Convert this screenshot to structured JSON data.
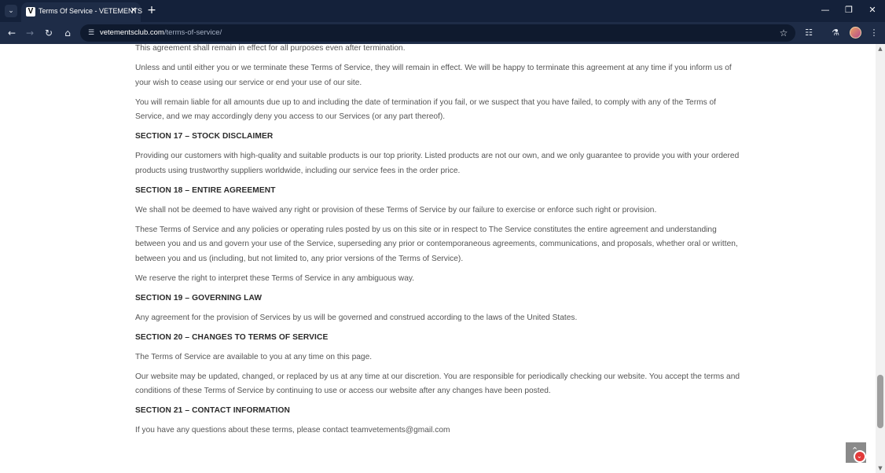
{
  "browser": {
    "tab": {
      "favicon_letter": "V",
      "title": "Terms Of Service - VETEMENTS"
    },
    "address": {
      "host": "vetementsclub.com",
      "path": "/terms-of-service/"
    },
    "icons": {
      "tab_search": "chevron-down-icon",
      "tab_close": "close-icon",
      "new_tab": "plus-icon",
      "minimize": "minimize-icon",
      "restore": "restore-icon",
      "close_window": "close-icon",
      "back": "arrow-left-icon",
      "forward": "arrow-right-icon",
      "reload": "reload-icon",
      "home": "home-icon",
      "site_info": "tune-icon",
      "bookmark": "star-icon",
      "extensions": "puzzle-icon",
      "labs": "flask-icon",
      "menu": "more-vertical-icon"
    },
    "colors": {
      "tabbar": "#14213a",
      "toolbar": "#1e2c47",
      "omnibox": "#0f1a2e"
    }
  },
  "page": {
    "blocks": [
      {
        "type": "p",
        "text": "This agreement shall remain in effect for all purposes even after termination."
      },
      {
        "type": "p",
        "text": "Unless and until either you or we terminate these Terms of Service, they will remain in effect. We will be happy to terminate this agreement at any time if you inform us of your wish to cease using our service or end your use of our site."
      },
      {
        "type": "p",
        "text": "You will remain liable for all amounts due up to and including the date of termination if you fail, or we suspect that you have failed, to comply with any of the Terms of Service, and we may accordingly deny you access to our Services (or any part thereof)."
      },
      {
        "type": "h",
        "text": "SECTION 17 – STOCK DISCLAIMER"
      },
      {
        "type": "p",
        "text": "Providing our customers with high-quality and suitable products is our top priority. Listed products are not our own, and we only guarantee to provide you with your ordered products using trustworthy suppliers worldwide, including our service fees in the order price."
      },
      {
        "type": "h",
        "text": "SECTION 18 – ENTIRE AGREEMENT"
      },
      {
        "type": "p",
        "text": "We shall not be deemed to have waived any right or provision of these Terms of Service by our failure to exercise or enforce such right or provision."
      },
      {
        "type": "p",
        "text": "These Terms of Service and any policies or operating rules posted by us on this site or in respect to The Service constitutes the entire agreement and understanding between you and us and govern your use of the Service, superseding any prior or contemporaneous agreements, communications, and proposals, whether oral or written, between you and us (including, but not limited to, any prior versions of the Terms of Service)."
      },
      {
        "type": "p",
        "text": "We reserve the right to interpret these Terms of Service in any ambiguous way."
      },
      {
        "type": "h",
        "text": "SECTION 19 – GOVERNING LAW"
      },
      {
        "type": "p",
        "text": "Any agreement for the provision of Services by us will be governed and construed according to the laws of the United States."
      },
      {
        "type": "h",
        "text": "SECTION 20 – CHANGES TO TERMS OF SERVICE"
      },
      {
        "type": "p",
        "text": "The Terms of Service are available to you at any time on this page."
      },
      {
        "type": "p",
        "text": "Our website may be updated, changed, or replaced by us at any time at our discretion. You are responsible for periodically checking our website. You accept the terms and conditions of these Terms of Service by continuing to use or access our website after any changes have been posted."
      },
      {
        "type": "h",
        "text": "SECTION 21 – CONTACT INFORMATION"
      },
      {
        "type": "p",
        "text": "If you have any questions about these terms, please contact teamvetements@gmail.com"
      }
    ],
    "back_to_top_icon": "arrow-up-icon",
    "chat_badge_icon": "chat-badge-icon",
    "colors": {
      "body_text": "#555555",
      "heading_text": "#2b2b2b",
      "back_to_top": "#8a8a8a",
      "badge": "#e23b3b"
    }
  }
}
